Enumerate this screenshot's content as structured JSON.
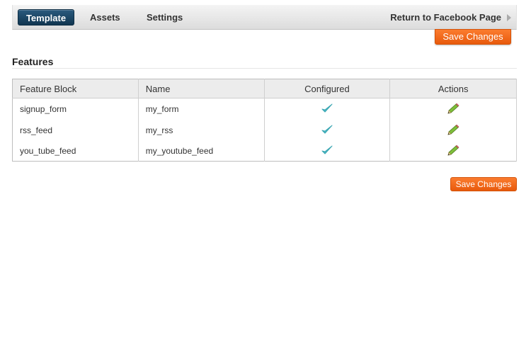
{
  "nav": {
    "tabs": [
      {
        "label": "Template",
        "active": true
      },
      {
        "label": "Assets",
        "active": false
      },
      {
        "label": "Settings",
        "active": false
      }
    ],
    "return_link": "Return to Facebook Page"
  },
  "actions": {
    "save_top": "Save Changes",
    "save_bottom": "Save Changes"
  },
  "features": {
    "title": "Features",
    "columns": [
      "Feature Block",
      "Name",
      "Configured",
      "Actions"
    ],
    "rows": [
      {
        "block": "signup_form",
        "name": "my_form",
        "configured": true,
        "action_icon": "pencil-icon"
      },
      {
        "block": "rss_feed",
        "name": "my_rss",
        "configured": true,
        "action_icon": "pencil-icon"
      },
      {
        "block": "you_tube_feed",
        "name": "my_youtube_feed",
        "configured": true,
        "action_icon": "pencil-icon"
      }
    ]
  },
  "colors": {
    "nav_active": "#1b4566",
    "accent_orange": "#f26a1b",
    "check": "#4cb8c4"
  }
}
